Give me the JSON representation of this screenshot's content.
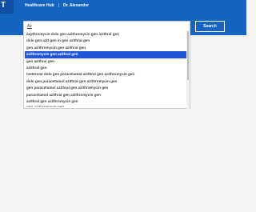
{
  "header": {
    "logo": "T",
    "title": "Healthcare Hub",
    "separator": "|",
    "user": "Dr. Alexander"
  },
  "search": {
    "query_value": "Az",
    "button_label": "Search"
  },
  "suggestions": [
    {
      "label": "azyt⁠hromycin dolo gen azithromycin gen azithral gen"
    },
    {
      "label": "dolo gen azit   gen   in gen azithral gen"
    },
    {
      "label": "gen azithromycin gen azithral gen"
    },
    {
      "label": "azithromycin gen azithral gen"
    },
    {
      "label": "gen azithral gen"
    },
    {
      "label": "azithral gen"
    },
    {
      "label": "meterone dolo gen paracetamol azithral gen azithromycin gen"
    },
    {
      "label": "dolo gen paracetamol azithral gen azithromycin gen"
    },
    {
      "label": "gen paracetamol azithral gen azithromycin gen"
    },
    {
      "label": "paracetamol azithral gen azithromycin gen"
    },
    {
      "label": "azithral gen azithromycin gen"
    },
    {
      "label": "gen azithromycin gen"
    }
  ],
  "selected_index": 3,
  "colors": {
    "brand": "#1565c0",
    "selected": "#1e56d9"
  }
}
